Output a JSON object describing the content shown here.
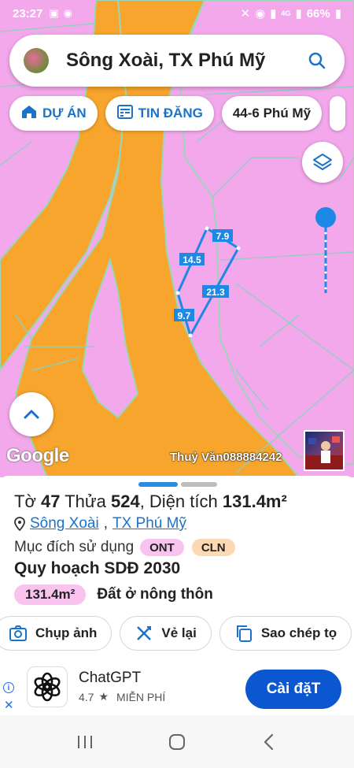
{
  "status_bar": {
    "time": "23:27",
    "battery": "66%",
    "network": "4G"
  },
  "search": {
    "title": "Sông Xoài, TX Phú Mỹ"
  },
  "chips": [
    {
      "label": "DỰ ÁN",
      "icon": "house-icon"
    },
    {
      "label": "TIN ĐĂNG",
      "icon": "list-icon"
    },
    {
      "label": "44-6 Phú Mỹ",
      "icon": ""
    }
  ],
  "map": {
    "edge_labels": [
      "7.9",
      "14.5",
      "21.3",
      "9.7"
    ],
    "google_label": "Google",
    "watermark": "Thuỷ Văn088884242"
  },
  "parcel": {
    "to_label": "Tờ",
    "to_value": "47",
    "thua_label": "Thửa",
    "thua_value": "524",
    "area_label": "Diện tích",
    "area_value": "131.4m²",
    "location_1": "Sông Xoài",
    "location_2": "TX Phú Mỹ",
    "purpose_label": "Mục đích sử dụng",
    "purpose_tags": [
      "ONT",
      "CLN"
    ],
    "plan_title": "Quy hoạch SDĐ 2030",
    "plan_area": "131.4m²",
    "plan_desc": "Đất ở nông thôn"
  },
  "actions": [
    {
      "label": "Chụp ảnh",
      "icon": "camera-icon"
    },
    {
      "label": "Vẻ lại",
      "icon": "redraw-icon"
    },
    {
      "label": "Sao chép tọ",
      "icon": "copy-icon"
    }
  ],
  "ad": {
    "app_name": "ChatGPT",
    "rating": "4.7",
    "price": "MIỄN PHÍ",
    "install_label": "Cài đặT"
  },
  "colors": {
    "map_base": "#f3a8ec",
    "road_orange": "#f7a52c",
    "accent_blue": "#1a73c8",
    "ont_pink": "#f9c3f0",
    "cln_peach": "#fbd9b3"
  }
}
